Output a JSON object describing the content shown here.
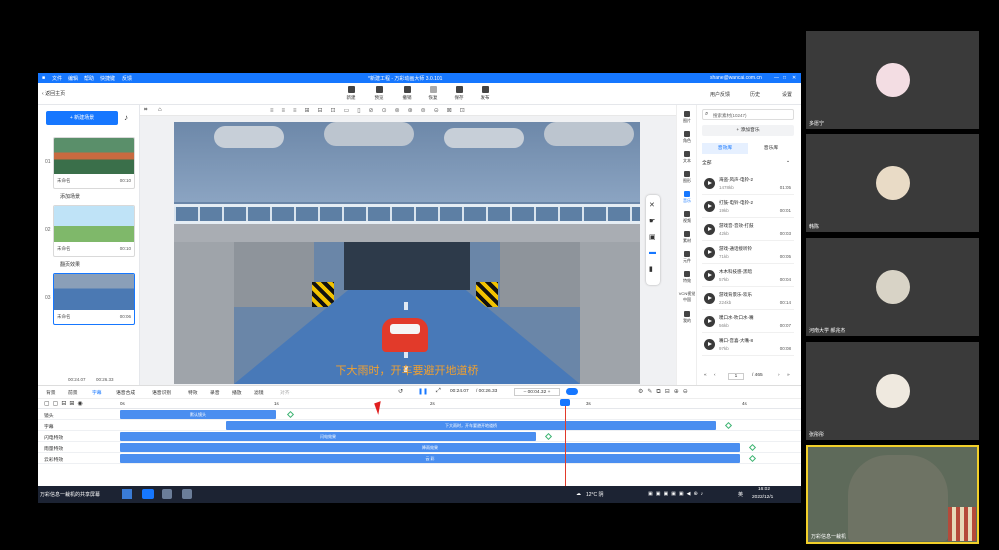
{
  "window": {
    "menu": [
      "文件",
      "编辑",
      "帮助",
      "快捷键",
      "反馈"
    ],
    "title": "*新建工程 - 万彩动画大师 3.0.101",
    "account": "shane@wancai.com.cn",
    "back": "返回主页"
  },
  "toolbar": {
    "buttons": [
      "新建",
      "预览",
      "撤销",
      "恢复",
      "保存",
      "发布"
    ],
    "right": [
      "用户反馈",
      "历史",
      "设置"
    ]
  },
  "left_panel": {
    "add_scene": "+ 新建场景",
    "scenes": [
      {
        "num": "01",
        "name": "未命名",
        "duration": "00:10",
        "caption": "添加场景"
      },
      {
        "num": "02",
        "name": "未命名",
        "duration": "00:10",
        "caption": "翻页效果"
      },
      {
        "num": "03",
        "name": "未命名",
        "duration": "00:06",
        "caption": ""
      }
    ],
    "time": "00:24.07",
    "total": "00:26.33"
  },
  "stage": {
    "subtitle": "下大雨时，开车要避开地道桥"
  },
  "right_rail": [
    "图片",
    "角色",
    "文本",
    "图形",
    "音乐",
    "视频",
    "素材",
    "元件",
    "特效",
    "VCN视觉中国",
    "我的"
  ],
  "media_panel": {
    "search_placeholder": "搜索素材(10247)",
    "add_label": "+ 添加音乐",
    "tabs": [
      "音效库",
      "音乐库"
    ],
    "filter": "全部",
    "items": [
      {
        "title": "海盗-风声-电铃-2",
        "size": "1478kb",
        "duration": "01:05"
      },
      {
        "title": "打鼓-电铃-电铃-2",
        "size": "19kb",
        "duration": "00:01"
      },
      {
        "title": "游戏音-音效-打鼓",
        "size": "42kb",
        "duration": "00:03"
      },
      {
        "title": "游戏-通话接听铃",
        "size": "71kb",
        "duration": "00:05"
      },
      {
        "title": "木木科技感-黑暗",
        "size": "57kb",
        "duration": "00:04"
      },
      {
        "title": "游戏背景乐-欢乐",
        "size": "224kb",
        "duration": "00:14"
      },
      {
        "title": "噗口水-吹口水-嘴",
        "size": "56kb",
        "duration": "00:07"
      },
      {
        "title": "嘴口-音喜-大嘴-8",
        "size": "97kb",
        "duration": "00:08"
      }
    ],
    "page": "1",
    "pages": "/ 465"
  },
  "timeline_bar": {
    "tools": [
      "背景",
      "前景",
      "字幕",
      "语音合成",
      "语音识别",
      "特效",
      "录音",
      "播放",
      "滤镜",
      "对齐"
    ],
    "current": "00:24.07",
    "total": "/ 00:26.33",
    "zoom": "00:04.32"
  },
  "timeline": {
    "ruler": [
      "0s",
      "1s",
      "2s",
      "3s",
      "4s"
    ],
    "tracks": [
      {
        "label": "镜头",
        "clip": "默认镜头"
      },
      {
        "label": "字幕",
        "clip": "下大雨时，开车要避开地道桥"
      },
      {
        "label": "闪电特效",
        "clip": "闪电效果"
      },
      {
        "label": "雨量特效",
        "clip": "降雨效果"
      },
      {
        "label": "云彩特效",
        "clip": "云 彩"
      }
    ]
  },
  "status": {
    "left": "当前场景: 03  未命名"
  },
  "taskbar": {
    "label": "万彩信息一裁机的共享屏幕",
    "weather": "12°C 阴",
    "time": "16:02",
    "date": "2022/12/1",
    "lang": "英"
  },
  "participants": [
    {
      "name": "多愿宁"
    },
    {
      "name": "韩陈"
    },
    {
      "name": "河南大学  郝兆杰"
    },
    {
      "name": "张彤彤"
    },
    {
      "name": "万彩信息一裁机"
    }
  ]
}
